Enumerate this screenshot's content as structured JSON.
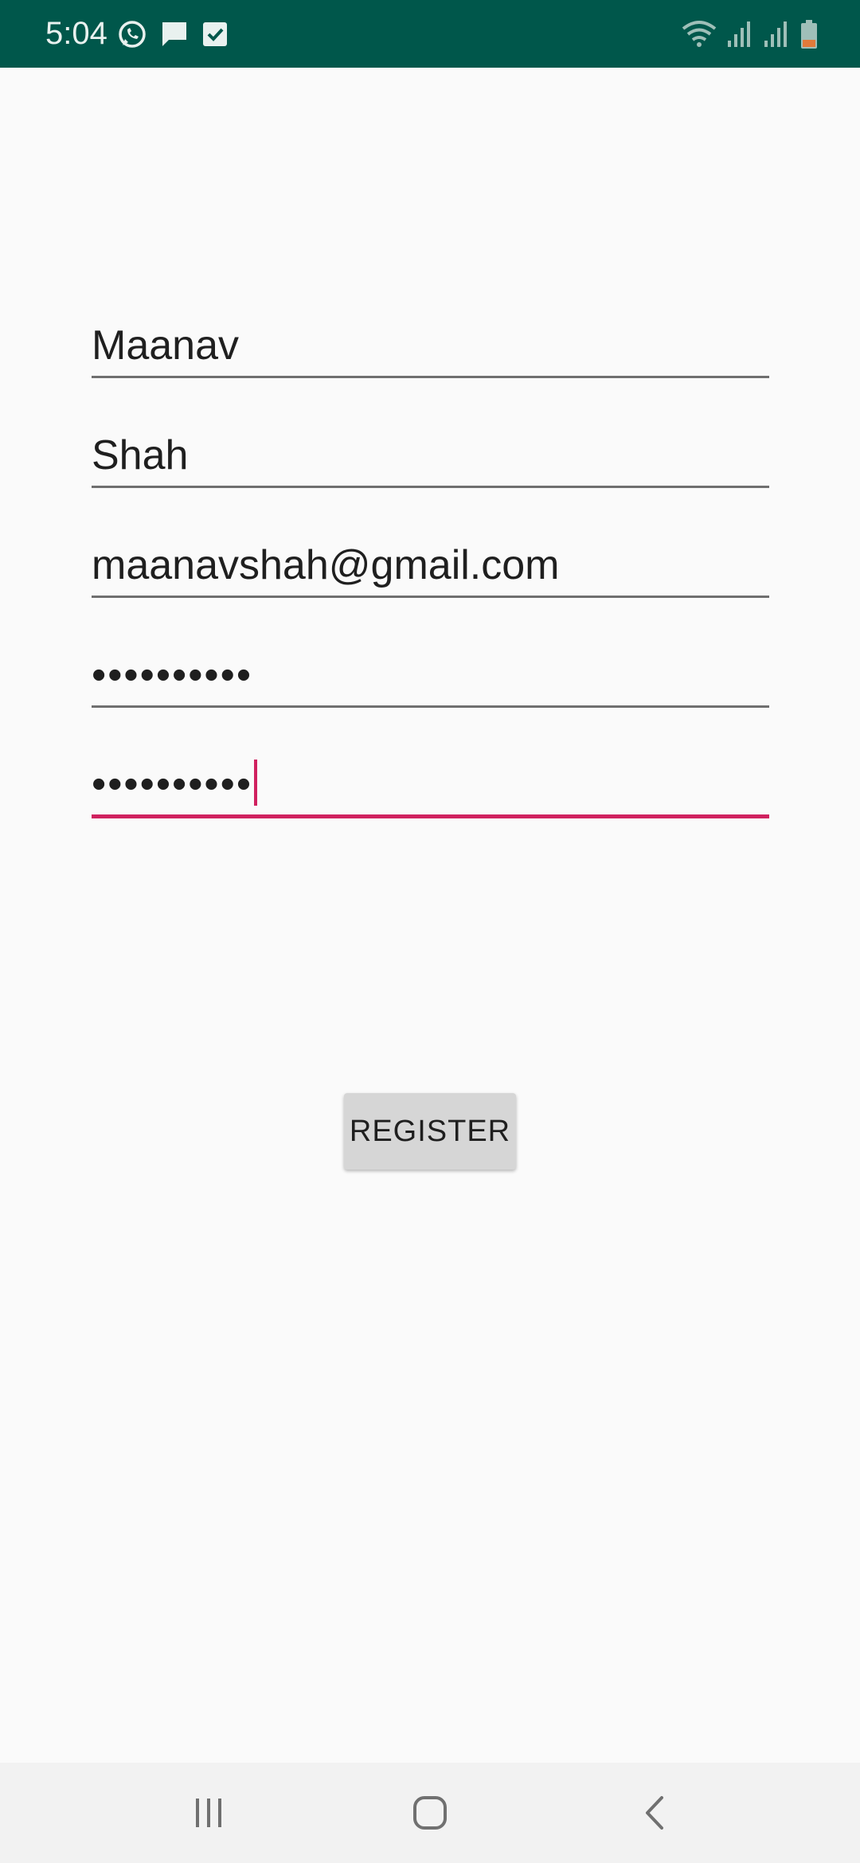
{
  "status_bar": {
    "time": "5:04",
    "background_color": "#00574b",
    "left_icons": [
      "whatsapp-icon",
      "message-icon",
      "checkbox-icon"
    ],
    "right_icons": [
      "wifi-icon",
      "signal-icon",
      "signal-icon",
      "battery-icon"
    ]
  },
  "form": {
    "first_name": {
      "value": "Maanav"
    },
    "last_name": {
      "value": "Shah"
    },
    "email": {
      "value": "maanavshah@gmail.com"
    },
    "password": {
      "value": "••••••••••"
    },
    "confirm_password": {
      "value": "••••••••••",
      "focused": true
    }
  },
  "register_button": {
    "label": "REGISTER"
  },
  "nav_bar": {
    "buttons": [
      "recent-apps-icon",
      "home-icon",
      "back-icon"
    ]
  },
  "colors": {
    "accent": "#d0215f",
    "underline": "#6f6f6f",
    "background": "#fafafa"
  }
}
